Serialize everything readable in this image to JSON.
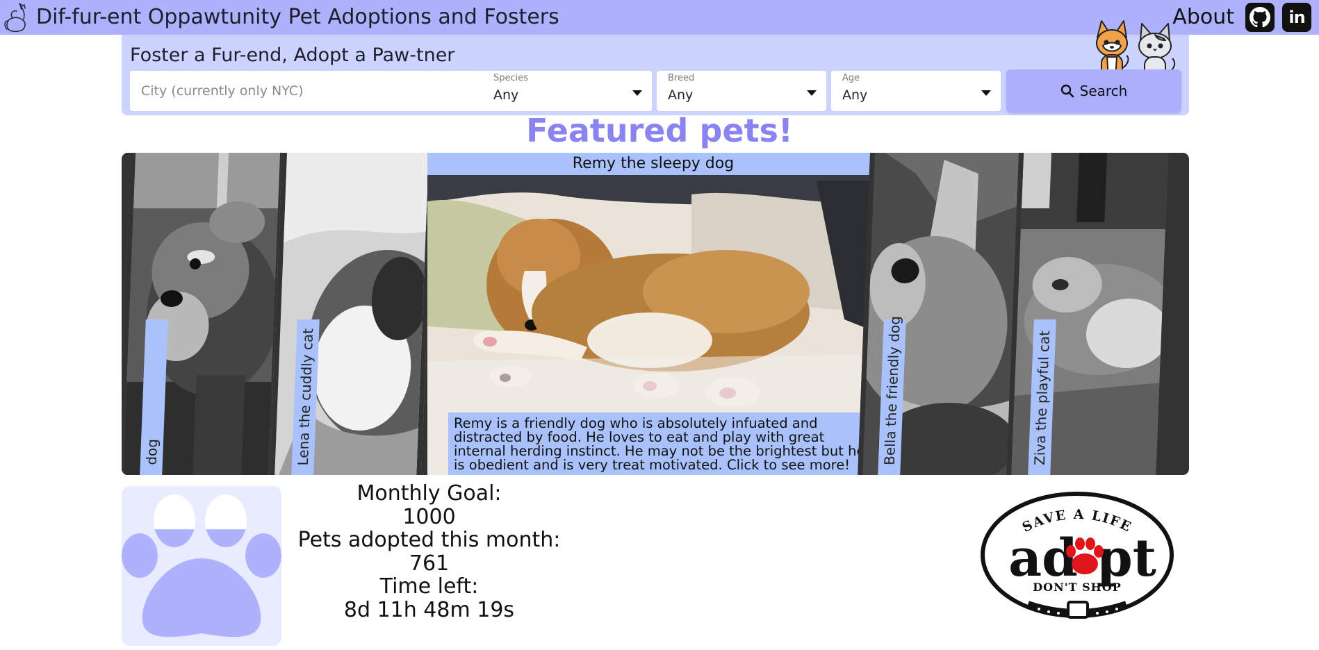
{
  "navbar": {
    "title": "Dif-fur-ent Oppawtunity Pet Adoptions and Fosters",
    "about_label": "About",
    "linkedin_text": "in",
    "icons": [
      "cat-logo-icon",
      "github-icon",
      "linkedin-icon"
    ]
  },
  "search": {
    "heading": "Foster a Fur-end, Adopt a Paw-tner",
    "city_placeholder": "City (currently only NYC)",
    "species": {
      "label": "Species",
      "value": "Any"
    },
    "breed": {
      "label": "Breed",
      "value": "Any"
    },
    "age": {
      "label": "Age",
      "value": "Any"
    },
    "button_label": "Search"
  },
  "featured": {
    "title": "Featured pets!",
    "slides": [
      {
        "label": "dog"
      },
      {
        "label": "Lena the cuddly cat"
      },
      {
        "label": "Remy the sleepy dog",
        "description": "Remy is a friendly dog who is absolutely infuated and distracted by food. He loves to eat and play with great internal herding instinct. He may not be the brightest but he is obedient and is very treat motivated. Click to see more!"
      },
      {
        "label": "Bella the friendly dog"
      },
      {
        "label": "Ziva the playful cat"
      }
    ]
  },
  "goal": {
    "monthly_goal_label": "Monthly Goal:",
    "monthly_goal_value": "1000",
    "adopted_label": "Pets adopted this month:",
    "adopted_value": "761",
    "time_left_label": "Time left:",
    "time_left_value": "8d 11h 48m 19s",
    "progress_fraction": 0.761
  },
  "badge": {
    "top_text": "SAVE A LIFE",
    "main_left": "ad",
    "main_right": "pt",
    "bottom_text": "DON'T SHOP"
  },
  "colors": {
    "nav_bg": "#aeb2fc",
    "panel_bg": "#cdd3ff",
    "accent": "#8a84f0",
    "caption_bg": "#aac2fb",
    "paw": "#aeb2fc"
  }
}
